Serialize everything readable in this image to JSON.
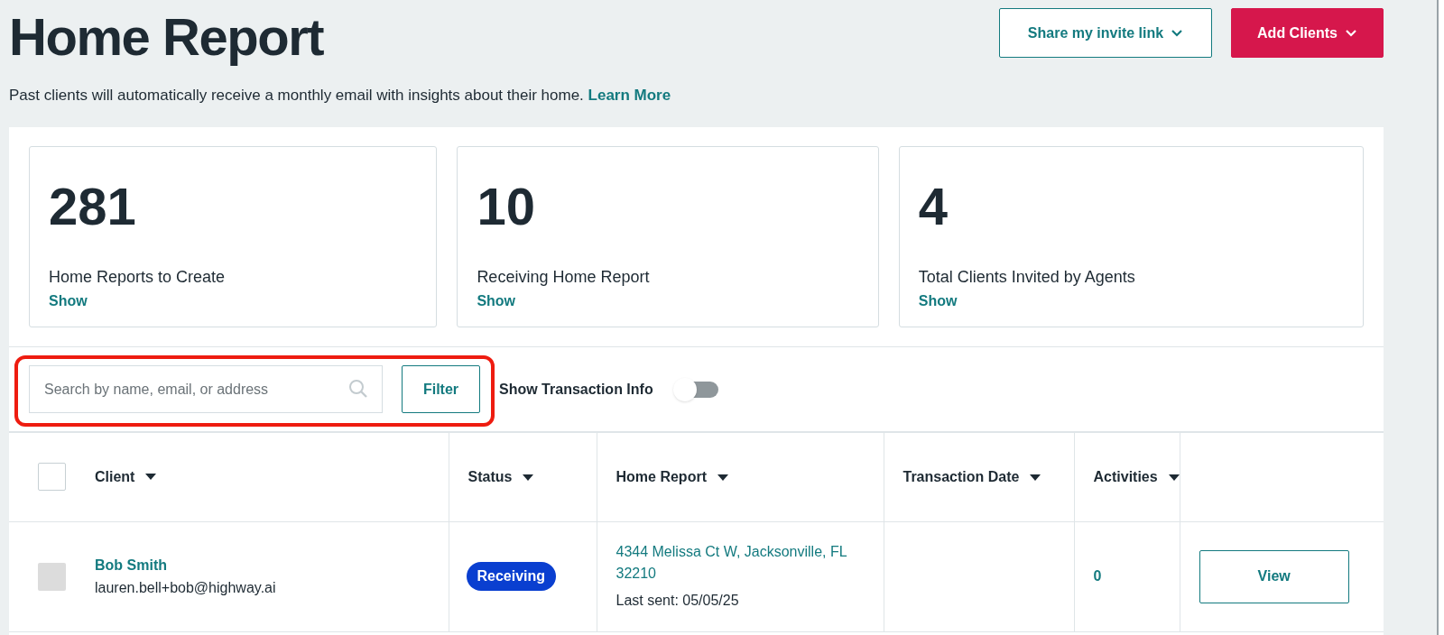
{
  "header": {
    "title": "Home Report",
    "buttons": [
      {
        "label": "Share my invite link",
        "kind": "outline"
      },
      {
        "label": "Add Clients",
        "kind": "primary"
      }
    ]
  },
  "intro": {
    "text": "Past clients will automatically receive a monthly email with insights about their home.",
    "link": "Learn More"
  },
  "stats": [
    {
      "value": "281",
      "label": "Home Reports to Create",
      "link": "Show"
    },
    {
      "value": "10",
      "label": "Receiving Home Report",
      "link": "Show"
    },
    {
      "value": "4",
      "label": "Total Clients Invited by Agents",
      "link": "Show"
    }
  ],
  "toolbar": {
    "search": {
      "placeholder": "Search by name, email, or address"
    },
    "filter_button": "Filter",
    "toggle": {
      "label": "Show Transaction Info",
      "on": false
    },
    "highlighted": true
  },
  "table": {
    "select_all": {
      "checked": false
    },
    "columns": [
      "Client",
      "Status",
      "Home Report",
      "Transaction Date",
      "Activities"
    ],
    "rows": [
      {
        "checked": false,
        "name": "Bob Smith",
        "email": "lauren.bell+bob@highway.ai",
        "status": "Receiving",
        "address": "4344 Melissa Ct W, Jacksonville, FL 32210",
        "last_sent": "Last sent: 05/05/25",
        "transaction_date": "",
        "activities": "0",
        "action": "View"
      }
    ]
  }
}
